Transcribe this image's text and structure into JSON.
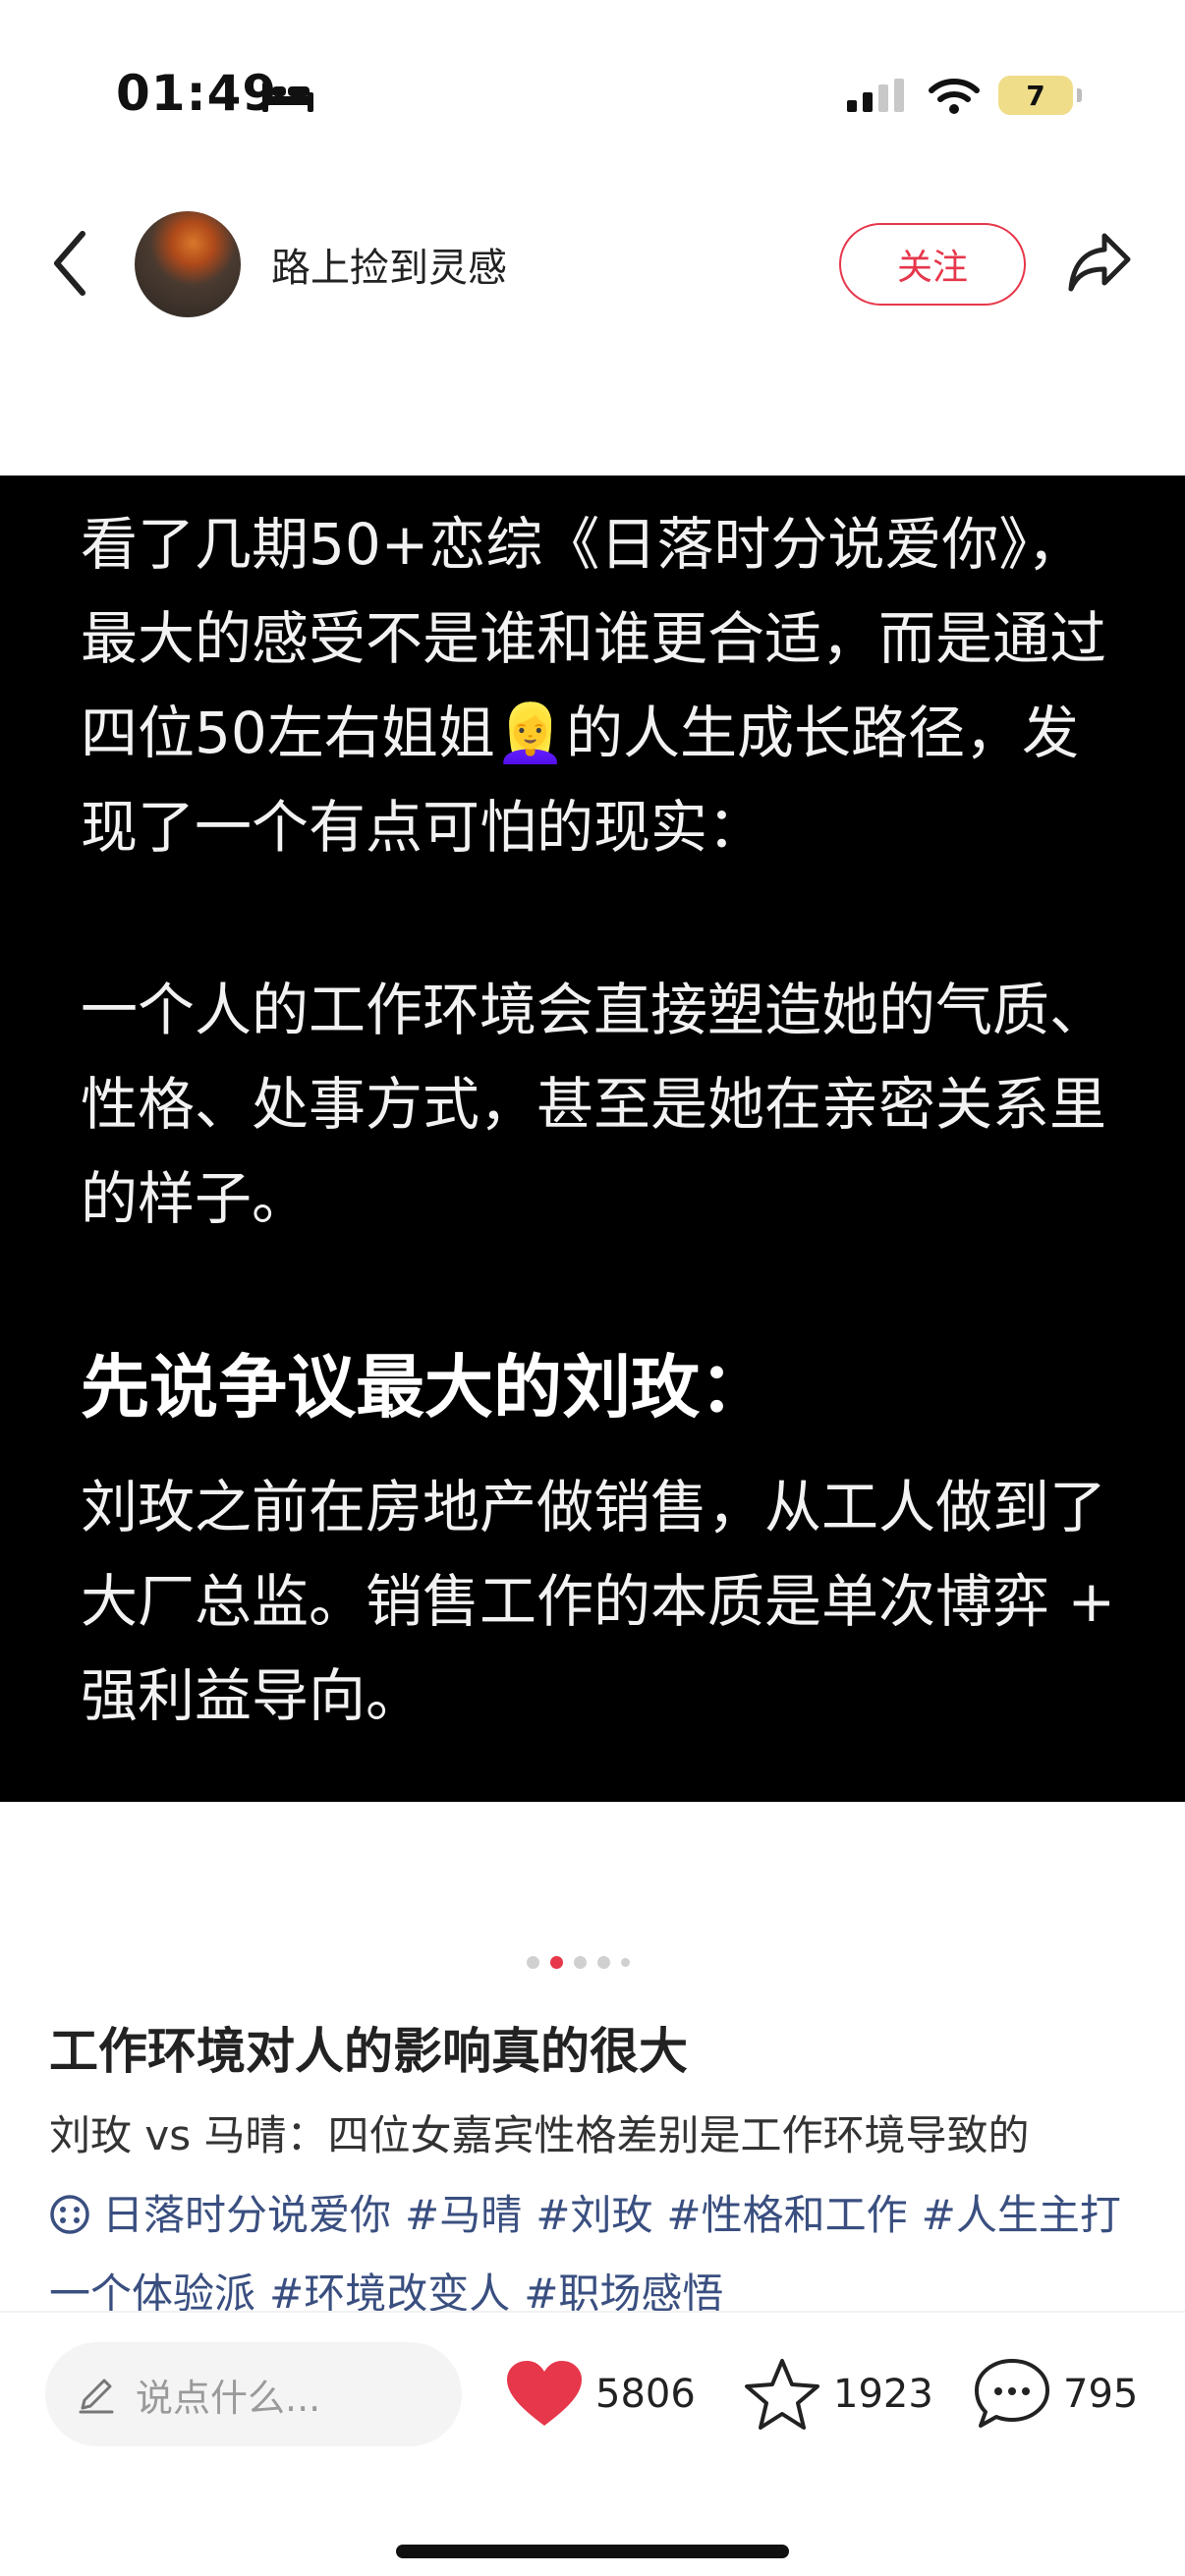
{
  "status_bar": {
    "time": "01:49",
    "battery": "7"
  },
  "header": {
    "username": "路上捡到灵感",
    "follow_label": "关注"
  },
  "image": {
    "paragraph1": "看了几期50+恋综《日落时分说爱你》，最大的感受不是谁和谁更合适，而是通过四位50左右姐姐👱‍♀️的人生成长路径，发现了一个有点可怕的现实：",
    "paragraph2": "一个人的工作环境会直接塑造她的气质、性格、处事方式，甚至是她在亲密关系里的样子。",
    "heading": "先说争议最大的刘玫：",
    "paragraph3": "刘玫之前在房地产做销售，从工人做到了大厂总监。销售工作的本质是单次博弈 + 强利益导向。"
  },
  "carousel": {
    "total": 5,
    "active": 2
  },
  "post": {
    "title": "工作环境对人的影响真的很大",
    "description": "刘玫 vs 马晴：四位女嘉宾性格差别是工作环境导致的",
    "tags": [
      "日落时分说爱你",
      "#马晴",
      "#刘玫",
      "#性格和工作",
      "#人生主打一个体验派",
      "#环境改变人",
      "#职场感悟"
    ]
  },
  "bottom_bar": {
    "comment_placeholder": "说点什么...",
    "likes": "5806",
    "favorites": "1923",
    "comments": "795"
  },
  "colors": {
    "accent": "#e6374b",
    "tag": "#3a4f80",
    "card_bg": "#000000"
  }
}
